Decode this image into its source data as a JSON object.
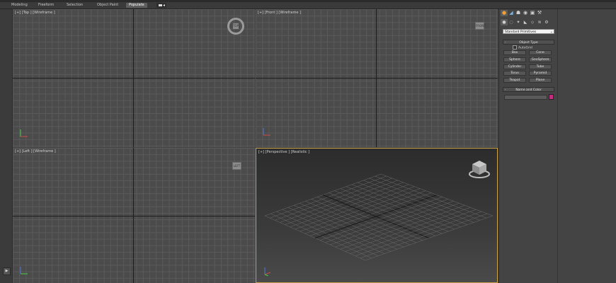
{
  "ribbon": {
    "tabs": [
      {
        "label": "Modeling",
        "active": false
      },
      {
        "label": "Freeform",
        "active": false
      },
      {
        "label": "Selection",
        "active": false
      },
      {
        "label": "Object Paint",
        "active": false
      },
      {
        "label": "Populate",
        "active": true
      }
    ],
    "dropdown_icon": "camera-icon"
  },
  "viewports": {
    "top": {
      "label": "[+] [Top ] [Wireframe ]",
      "navcube_text": "TOP"
    },
    "front": {
      "label": "[+] [Front ] [Wireframe ]",
      "navcube_text": "FRONT"
    },
    "left": {
      "label": "[+] [Left ] [Wireframe ]",
      "navcube_text": "LEFT"
    },
    "perspective": {
      "label": "[+] [Perspective ] [Realistic ]"
    }
  },
  "command_panel": {
    "tabs": [
      "create-tab",
      "modify-tab",
      "hierarchy-tab",
      "motion-tab",
      "display-tab",
      "utilities-tab"
    ],
    "categories": [
      "geometry",
      "shapes",
      "lights",
      "cameras",
      "helpers",
      "space-warps",
      "systems"
    ],
    "dropdown_value": "Standard Primitives",
    "object_type": {
      "title": "Object Type",
      "autogrid_label": "AutoGrid",
      "buttons": [
        "Box",
        "Cone",
        "Sphere",
        "GeoSphere",
        "Cylinder",
        "Tube",
        "Torus",
        "Pyramid",
        "Teapot",
        "Plane"
      ]
    },
    "name_and_color": {
      "title": "Name and Color",
      "name_value": "",
      "color": "#c0307f"
    }
  },
  "colors": {
    "viewport_bg": "#4b4b4b",
    "active_border": "#c8a04a",
    "grid_line": "#5a5a5a"
  }
}
